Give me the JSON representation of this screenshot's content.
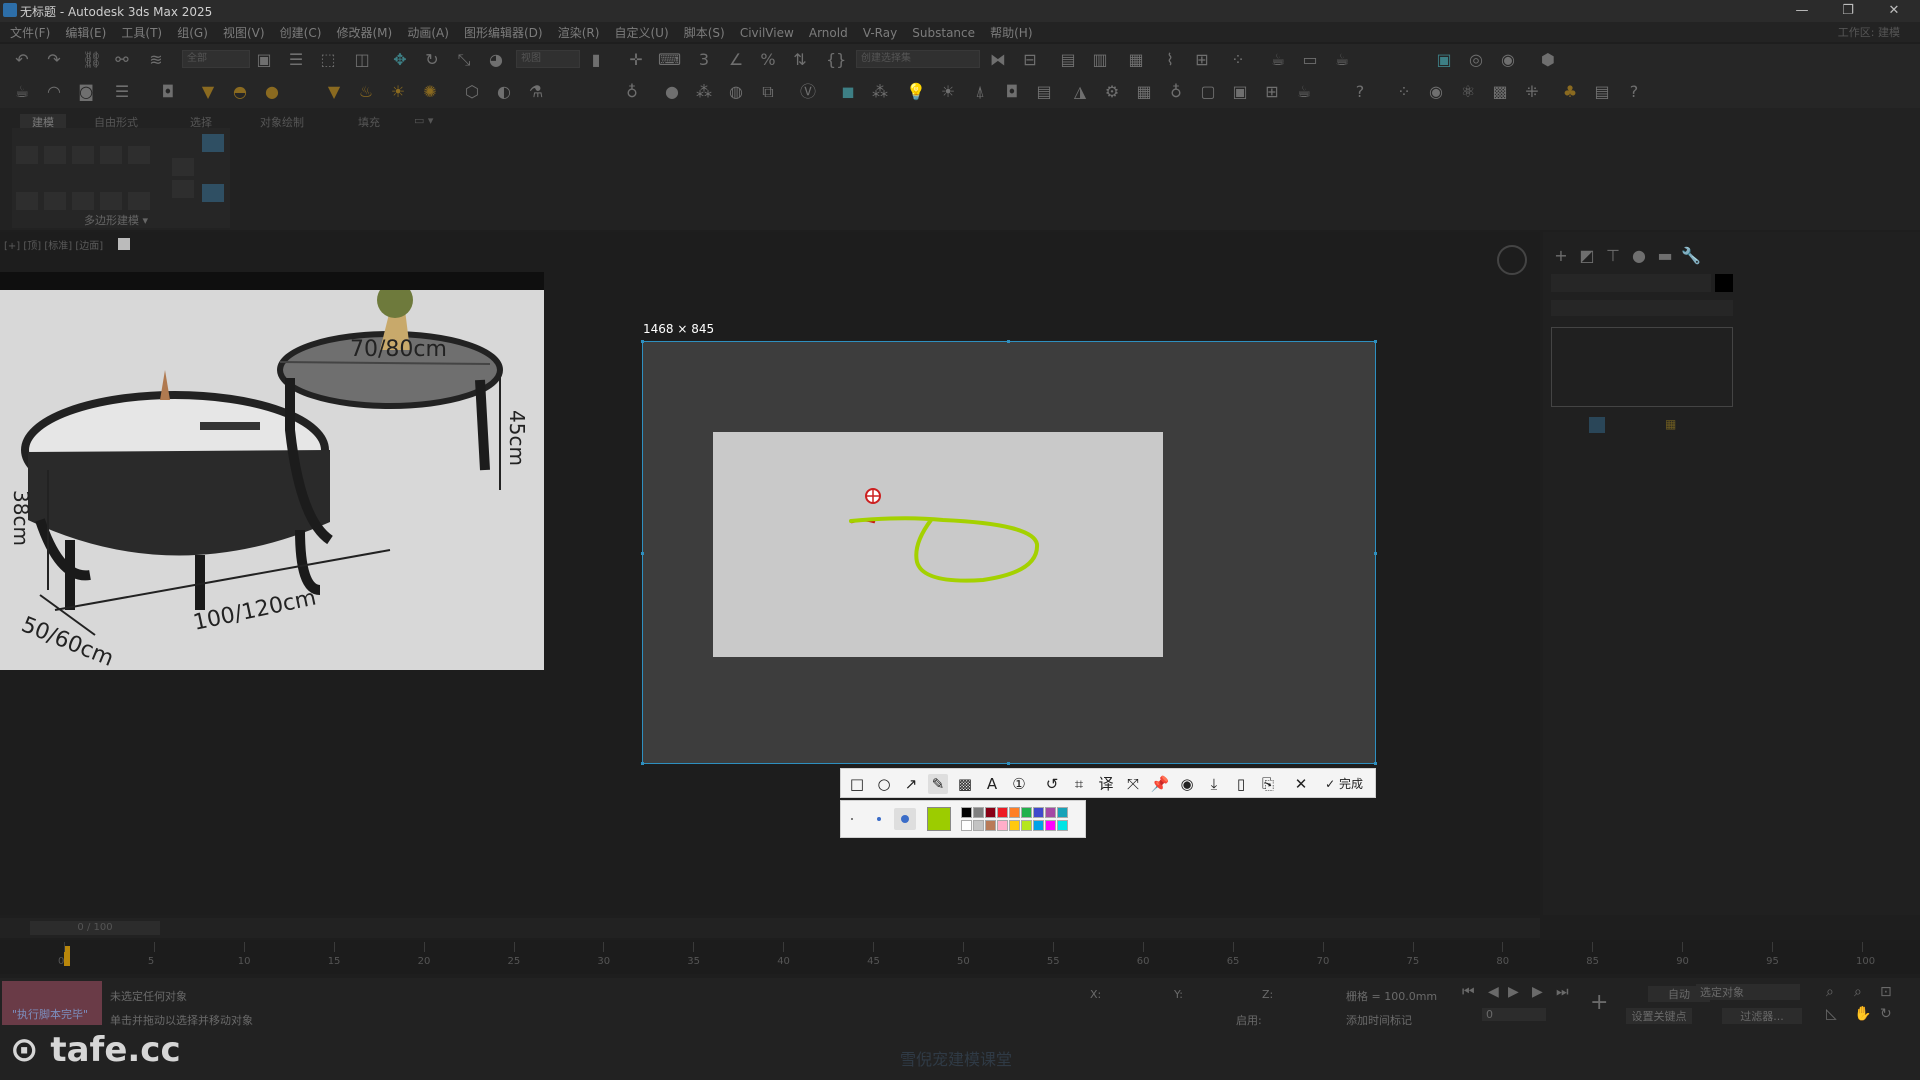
{
  "window": {
    "title": "无标题 - Autodesk 3ds Max 2025",
    "minimize": "—",
    "restore": "❐",
    "close": "✕"
  },
  "menu": {
    "items": [
      "文件(F)",
      "编辑(E)",
      "工具(T)",
      "组(G)",
      "视图(V)",
      "创建(C)",
      "修改器(M)",
      "动画(A)",
      "图形编辑器(D)",
      "渲染(R)",
      "自定义(U)",
      "脚本(S)",
      "CivilView",
      "Arnold",
      "V-Ray",
      "Substance",
      "帮助(H)"
    ],
    "workspace": "工作区: 建模"
  },
  "toolbar": {
    "selection_filter": "全部",
    "view_dropdown": "视图",
    "named_sets": "创建选择集"
  },
  "ribbon": {
    "tabs": [
      "建模",
      "自由形式",
      "选择",
      "对象绘制",
      "填充"
    ],
    "panel_label": "多边形建模 ▾"
  },
  "viewport": {
    "label": "[+] [顶] [标准] [边面]"
  },
  "reference_image": {
    "dim_top": "70/80cm",
    "dim_height_right": "45cm",
    "dim_height_left": "38cm",
    "dim_depth": "50/60cm",
    "dim_length": "100/120cm"
  },
  "capture": {
    "size_label": "1468 × 845",
    "done_label": "完成",
    "tools": [
      "rectangle-icon",
      "ellipse-icon",
      "arrow-icon",
      "pencil-icon",
      "mosaic-icon",
      "text-icon",
      "number-marker-icon",
      "undo-icon",
      "ocr-icon",
      "translate-icon",
      "scroll-capture-icon",
      "pin-icon",
      "record-icon",
      "save-icon",
      "copy-icon",
      "bookmark-icon",
      "close-icon"
    ],
    "active_tool": "pencil-icon",
    "selected_color": "#9ccc00",
    "palette": [
      "#000000",
      "#7f7f7f",
      "#880015",
      "#ed1c24",
      "#ff7f27",
      "#22b14c",
      "#3f48cc",
      "#a349a4",
      "#17a2b8",
      "#ffffff",
      "#c3c3c3",
      "#b97a57",
      "#ffaec9",
      "#ffc90e",
      "#b5e61d",
      "#00a2e8",
      "#ff00ff",
      "#00e5e5"
    ]
  },
  "timeline": {
    "slider_value": "0 / 100",
    "ticks": [
      "0",
      "5",
      "10",
      "15",
      "20",
      "25",
      "30",
      "35",
      "40",
      "45",
      "50",
      "55",
      "60",
      "65",
      "70",
      "75",
      "80",
      "85",
      "90",
      "95",
      "100"
    ]
  },
  "status": {
    "script_label": "\"执行脚本完毕\"",
    "line1": "未选定任何对象",
    "line2": "单击并拖动以选择并移动对象",
    "grid": "栅格 = 100.0mm",
    "enable": "启用:",
    "add_tag": "添加时间标记",
    "auto": "自动",
    "selected_obj": "选定对象",
    "set_key": "设置关键点",
    "filter": "过滤器...",
    "frame": "0",
    "x_label": "X:",
    "y_label": "Y:",
    "z_label": "Z:"
  },
  "watermark": {
    "brand": "tafe.cc",
    "caption": "雪倪宠建模课堂"
  }
}
